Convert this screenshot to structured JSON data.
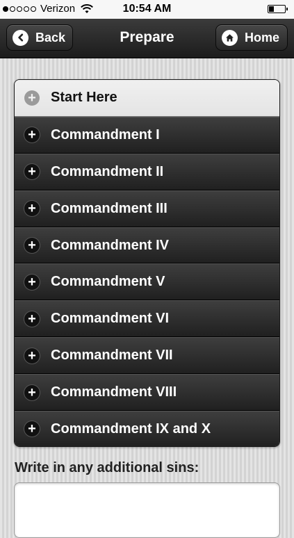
{
  "status_bar": {
    "carrier": "Verizon",
    "time": "10:54 AM",
    "signal_bars_filled": 1,
    "signal_bars_total": 5,
    "battery_level": 0.3
  },
  "nav": {
    "title": "Prepare",
    "back_label": "Back",
    "home_label": "Home",
    "back_icon": "chevron-left-icon",
    "home_icon": "home-icon"
  },
  "list": {
    "items": [
      {
        "label": "Start Here",
        "style": "light"
      },
      {
        "label": "Commandment I",
        "style": "dark"
      },
      {
        "label": "Commandment II",
        "style": "dark"
      },
      {
        "label": "Commandment III",
        "style": "dark"
      },
      {
        "label": "Commandment IV",
        "style": "dark"
      },
      {
        "label": "Commandment V",
        "style": "dark"
      },
      {
        "label": "Commandment VI",
        "style": "dark"
      },
      {
        "label": "Commandment VII",
        "style": "dark"
      },
      {
        "label": "Commandment VIII",
        "style": "dark"
      },
      {
        "label": "Commandment IX and X",
        "style": "dark"
      }
    ],
    "expand_symbol": "+"
  },
  "form": {
    "additional_sins_label": "Write in any additional sins:",
    "additional_sins_value": ""
  }
}
